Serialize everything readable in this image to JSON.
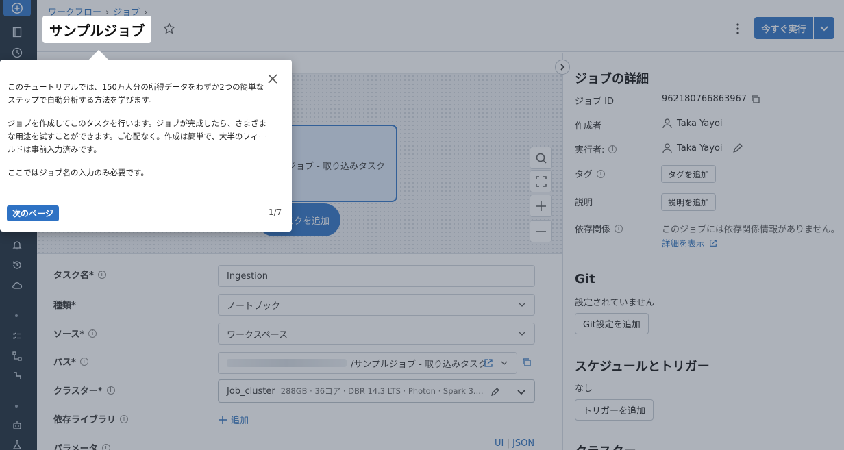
{
  "breadcrumb": {
    "items": [
      "ワークフロー",
      "ジョブ"
    ],
    "separator": "›"
  },
  "job": {
    "title": "サンプルジョブ"
  },
  "header": {
    "run_now": "今すぐ実行"
  },
  "canvas": {
    "task_node_label": "ジョブ - 取り込みタスク",
    "add_task": "タスクを追加"
  },
  "form": {
    "task_name": {
      "label": "タスク名*",
      "value": "Ingestion"
    },
    "type": {
      "label": "種類*",
      "value": "ノートブック"
    },
    "source": {
      "label": "ソース*",
      "value": "ワークスペース"
    },
    "path": {
      "label": "パス*",
      "value": "/サンプルジョブ - 取り込みタスク"
    },
    "cluster": {
      "label": "クラスター*",
      "value": "Job_cluster",
      "details": "288GB · 36コア · DBR 14.3 LTS · Photon · Spark 3...."
    },
    "libraries": {
      "label": "依存ライブラリ",
      "add": "追加"
    },
    "params": {
      "label": "パラメータ",
      "ui": "UI",
      "sep": "|",
      "json": "JSON"
    }
  },
  "details": {
    "heading": "ジョブの詳細",
    "job_id_label": "ジョブ ID",
    "job_id": "962180766863967",
    "creator_label": "作成者",
    "creator": "Taka Yayoi",
    "runner_label": "実行者:",
    "runner": "Taka Yayoi",
    "tags_label": "タグ",
    "add_tag": "タグを追加",
    "desc_label": "説明",
    "add_desc": "説明を追加",
    "deps_label": "依存関係",
    "deps_text": "このジョブには依存関係情報がありません。",
    "deps_link": "詳細を表示"
  },
  "git": {
    "heading": "Git",
    "status": "設定されていません",
    "add": "Git設定を追加"
  },
  "schedule": {
    "heading": "スケジュールとトリガー",
    "status": "なし",
    "add": "トリガーを追加"
  },
  "cluster_heading": "クラスター",
  "tutorial": {
    "p1": "このチュートリアルでは、150万人分の所得データをわずか2つの簡単なステップで自動分析する方法を学びます。",
    "p2": "ジョブを作成してこのタスクを行います。ジョブが完成したら、さまざまな用途を試すことができます。ご心配なく。作成は簡単で、大半のフィールドは事前入力済みです。",
    "p3": "ここではジョブ名の入力のみ必要です。",
    "next": "次のページ",
    "pager": "1/7"
  },
  "colors": {
    "accent": "#2e72c4",
    "rail": "#1b2a38",
    "overlay": "rgba(60,72,90,0.42)"
  },
  "icons": [
    "plus-icon",
    "notebook-icon",
    "clock-icon",
    "bell-icon",
    "history-icon",
    "cloud-icon",
    "checklist-icon",
    "workflow-icon",
    "pipeline-icon",
    "robot-icon",
    "flask-icon",
    "star-icon",
    "kebab-icon",
    "chevron-down-icon",
    "search-icon",
    "fit-icon",
    "zoom-in-icon",
    "zoom-out-icon",
    "copy-icon",
    "person-icon",
    "pencil-icon",
    "info-icon",
    "external-link-icon",
    "close-icon",
    "chevron-right-icon"
  ]
}
